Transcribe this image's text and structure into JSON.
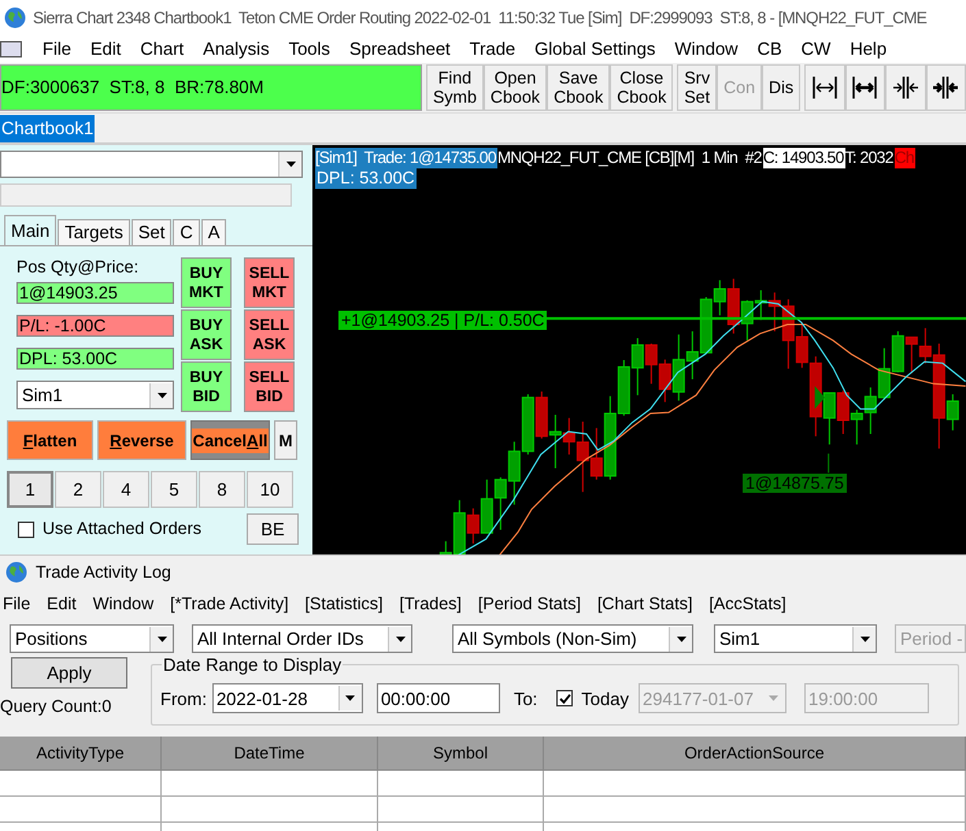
{
  "window": {
    "title": "Sierra Chart 2348 Chartbook1  Teton CME Order Routing 2022-02-01  11:50:32 Tue [Sim]  DF:2999093  ST:8, 8 - [MNQH22_FUT_CME"
  },
  "menu": [
    "File",
    "Edit",
    "Chart",
    "Analysis",
    "Tools",
    "Spreadsheet",
    "Trade",
    "Global Settings",
    "Window",
    "CB",
    "CW",
    "Help"
  ],
  "status_field": "DF:3000637  ST:8, 8  BR:78.80M",
  "toolbar": [
    {
      "kind": "text",
      "lines": [
        "Find",
        "Symb"
      ],
      "disabled": false,
      "group_start": true
    },
    {
      "kind": "text",
      "lines": [
        "Open",
        "Cbook"
      ],
      "disabled": false,
      "group_start": false
    },
    {
      "kind": "text",
      "lines": [
        "Save",
        "Cbook"
      ],
      "disabled": false,
      "group_start": false
    },
    {
      "kind": "text",
      "lines": [
        "Close",
        "Cbook"
      ],
      "disabled": false,
      "group_start": false
    },
    {
      "kind": "text",
      "lines": [
        "Srv",
        "Set"
      ],
      "disabled": false,
      "group_start": true
    },
    {
      "kind": "text",
      "lines": [
        "Con"
      ],
      "disabled": true,
      "group_start": false
    },
    {
      "kind": "text",
      "lines": [
        "Dis"
      ],
      "disabled": false,
      "group_start": false
    },
    {
      "kind": "expand",
      "group_start": true
    },
    {
      "kind": "expand-bold",
      "group_start": false
    },
    {
      "kind": "shrink",
      "group_start": false
    },
    {
      "kind": "shrink-bold",
      "group_start": false
    }
  ],
  "chartbook_tabs": [
    {
      "label": "Chartbook1",
      "selected": true
    }
  ],
  "trade_window": {
    "tabs": [
      {
        "label": "Main",
        "selected": true
      },
      {
        "label": "Targets",
        "selected": false
      },
      {
        "label": "Set",
        "selected": false
      },
      {
        "label": "C",
        "selected": false
      },
      {
        "label": "A",
        "selected": false
      }
    ],
    "position_label": "Pos Qty@Price:",
    "fields": [
      {
        "text": "1@14903.25",
        "kind": "gain"
      },
      {
        "text": "P/L: -1.00C",
        "kind": "loss"
      },
      {
        "text": "DPL: 53.00C",
        "kind": "gain"
      }
    ],
    "account": "Sim1",
    "order_buttons": [
      {
        "kind": "buy",
        "lines": [
          "BUY",
          "MKT"
        ]
      },
      {
        "kind": "sell",
        "lines": [
          "SELL",
          "MKT"
        ]
      },
      {
        "kind": "buy",
        "lines": [
          "BUY",
          "ASK"
        ]
      },
      {
        "kind": "sell",
        "lines": [
          "SELL",
          "ASK"
        ]
      },
      {
        "kind": "buy",
        "lines": [
          "BUY",
          "BID"
        ]
      },
      {
        "kind": "sell",
        "lines": [
          "SELL",
          "BID"
        ]
      }
    ],
    "actions": [
      {
        "key": "F",
        "after": "latten",
        "focused": false
      },
      {
        "key": "R",
        "after": "everse",
        "focused": false
      },
      {
        "before": "Cancel",
        "key": "A",
        "after": "ll",
        "focused": true
      }
    ],
    "menu_button": "M",
    "quantities": [
      {
        "label": "1",
        "selected": true
      },
      {
        "label": "2",
        "selected": false
      },
      {
        "label": "4",
        "selected": false
      },
      {
        "label": "5",
        "selected": false
      },
      {
        "label": "8",
        "selected": false
      },
      {
        "label": "10",
        "selected": false
      }
    ],
    "attached_orders": {
      "label": "Use Attached Orders",
      "checked": false
    },
    "be_button": "BE"
  },
  "chart": {
    "header": [
      {
        "text": "[Sim1]  Trade: 1@14735.00",
        "kind": "account"
      },
      {
        "text": "MNQH22_FUT_CME [CB][M]  1 Min  #2",
        "kind": "plain"
      },
      {
        "text": "C: 14903.50",
        "kind": "price"
      },
      {
        "text": "T: 2032",
        "kind": "plain"
      },
      {
        "text": "Ch",
        "kind": "alert"
      }
    ],
    "dpl": "DPL: 53.00C",
    "position_label": "+1@14903.25 | P/L: 0.50C",
    "fill_label": "1@14875.75"
  },
  "log": {
    "title": "Trade Activity Log",
    "menu": [
      "File",
      "Edit",
      "Window",
      "[*Trade Activity]",
      "[Statistics]",
      "[Trades]",
      "[Period Stats]",
      "[Chart Stats]",
      "[AccStats]"
    ],
    "filters": [
      {
        "value": "Positions"
      },
      {
        "value": "All Internal Order IDs"
      },
      {
        "value": "All Symbols (Non-Sim)"
      },
      {
        "value": "Sim1"
      }
    ],
    "period": "Period -",
    "apply": "Apply",
    "query_count": "Query Count:0",
    "date_range": {
      "legend": "Date Range to Display",
      "from_label": "From:",
      "from_date": "2022-01-28",
      "from_time": "00:00:00",
      "to_label": "To:",
      "today": {
        "label": "Today",
        "checked": true
      },
      "to_date": "294177-01-07",
      "to_time": "19:00:00"
    },
    "columns": [
      "ActivityType",
      "DateTime",
      "Symbol",
      "OrderActionSource"
    ]
  }
}
